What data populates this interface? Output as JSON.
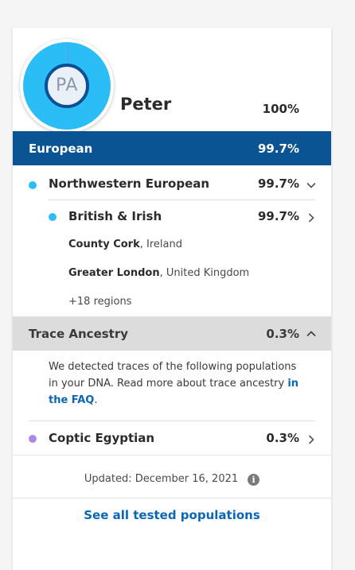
{
  "profile": {
    "initials": "PA",
    "name": "Peter",
    "total_percent": "100%"
  },
  "region": {
    "label": "European",
    "percent": "99.7%"
  },
  "northwestern": {
    "label": "Northwestern European",
    "percent": "99.7%",
    "dot_color": "#2bbdf5"
  },
  "british_irish": {
    "label": "British & Irish",
    "percent": "99.7%",
    "dot_color": "#2bbdf5",
    "locations": [
      {
        "bold": "County Cork",
        "rest": ", Ireland"
      },
      {
        "bold": "Greater London",
        "rest": ", United Kingdom"
      }
    ],
    "more_regions": "+18 regions"
  },
  "trace": {
    "label": "Trace Ancestry",
    "percent": "0.3%",
    "description": "We detected traces of the following populations in your DNA. Read more about trace ancestry ",
    "link_text": "in the FAQ",
    "after_link": "."
  },
  "coptic": {
    "label": "Coptic Egyptian",
    "percent": "0.3%",
    "dot_color": "#a98ae8"
  },
  "footer": {
    "updated": "Updated: December 16, 2021",
    "see_all": "See all tested populations"
  },
  "colors": {
    "region_bar": "#0b5494",
    "accent_link": "#0b67b5",
    "trace_bar": "#dcdcdc"
  }
}
